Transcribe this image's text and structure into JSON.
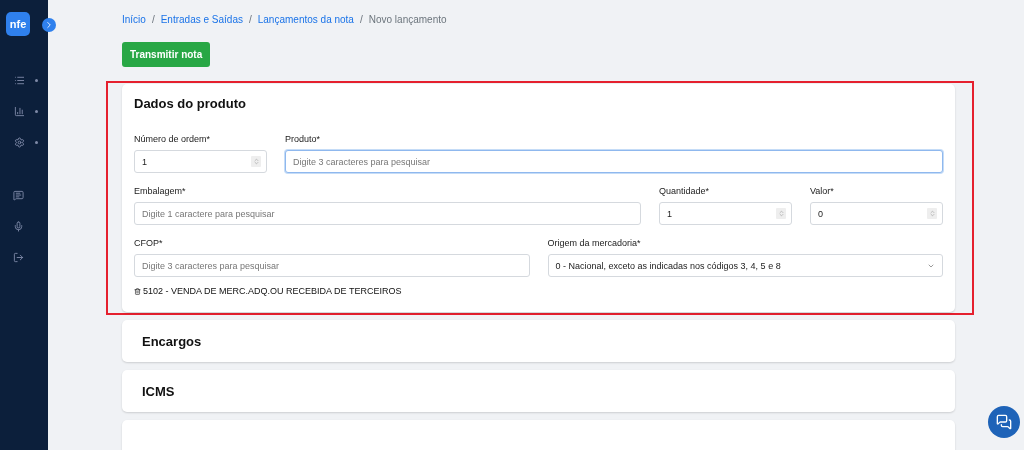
{
  "sidebar": {
    "logo": "nfe",
    "items": [
      {
        "kind": "list",
        "has_dot": true
      },
      {
        "kind": "chart",
        "has_dot": true
      },
      {
        "kind": "gear",
        "has_dot": true
      },
      {
        "kind": "help",
        "has_dot": false
      },
      {
        "kind": "mic",
        "has_dot": false
      },
      {
        "kind": "logout",
        "has_dot": false
      }
    ]
  },
  "breadcrumb": [
    {
      "label": "Início",
      "link": true
    },
    {
      "label": "Entradas e Saídas",
      "link": true
    },
    {
      "label": "Lançamentos da nota",
      "link": true
    },
    {
      "label": "Novo lançamento",
      "link": false
    }
  ],
  "breadcrumb_separators": [
    "/",
    "/",
    "/"
  ],
  "transmit_button": "Transmitir nota",
  "product_card": {
    "title": "Dados do produto",
    "highlighted": true,
    "rows": [
      [
        {
          "label": "Número de ordem*",
          "kind": "number",
          "value": "1",
          "focused": false
        },
        {
          "label": "Produto*",
          "kind": "text",
          "placeholder": "Digite 3 caracteres para pesquisar",
          "focused": true
        }
      ],
      [
        {
          "label": "Embalagem*",
          "kind": "text",
          "placeholder": "Digite 1 caractere para pesquisar",
          "focused": false
        },
        {
          "label": "Quantidade*",
          "kind": "number",
          "value": "1",
          "focused": false
        },
        {
          "label": "Valor*",
          "kind": "number",
          "value": "0",
          "focused": false
        }
      ],
      [
        {
          "label": "CFOP*",
          "kind": "text",
          "placeholder": "Digite 3 caracteres para pesquisar",
          "focused": false
        },
        {
          "label": "Origem da mercadoria*",
          "kind": "select",
          "value": "0 - Nacional, exceto as indicadas nos códigos 3, 4, 5 e 8",
          "focused": false
        }
      ]
    ],
    "cfop_selected": "5102 - VENDA DE MERC.ADQ.OU RECEBIDA DE TERCEIROS"
  },
  "sections": [
    {
      "title": "Encargos"
    },
    {
      "title": "ICMS"
    }
  ]
}
